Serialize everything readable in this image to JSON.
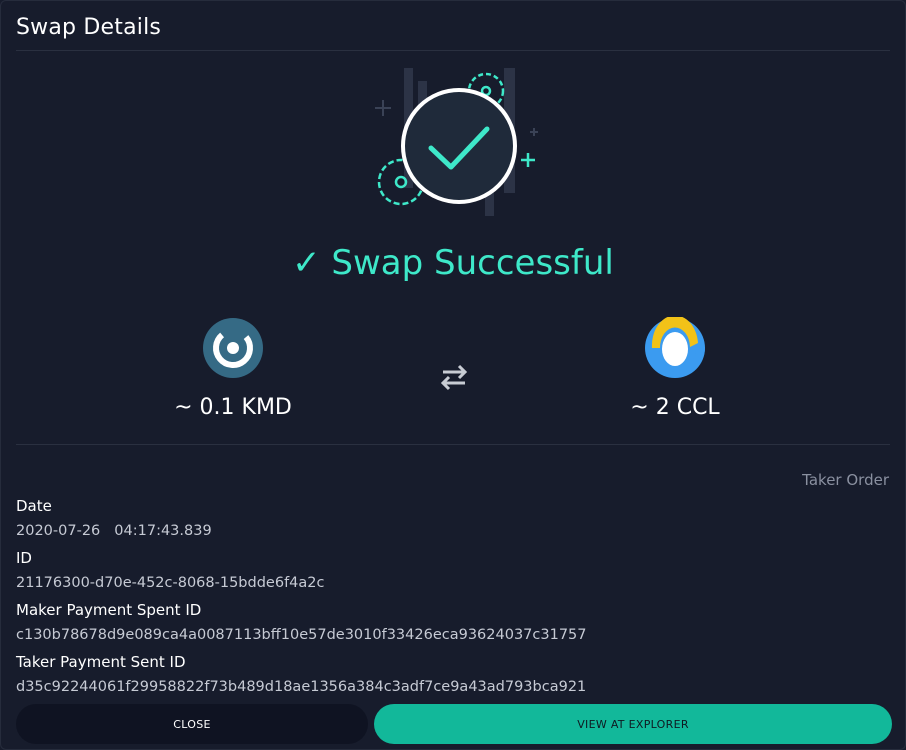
{
  "header": {
    "title": "Swap Details"
  },
  "status": {
    "text": "✓ Swap Successful",
    "color": "#3ee8c9"
  },
  "swap": {
    "from": {
      "amount": "~ 0.1 KMD",
      "icon": "kmd-coin-icon"
    },
    "to": {
      "amount": "~ 2 CCL",
      "icon": "ccl-coin-icon"
    },
    "direction_icon": "swap-arrows-icon"
  },
  "order_type": "Taker Order",
  "details": {
    "date_label": "Date",
    "date": "2020-07-26",
    "time": "04:17:43.839",
    "id_label": "ID",
    "id": "21176300-d70e-452c-8068-15bdde6f4a2c",
    "maker_label": "Maker Payment Spent ID",
    "maker_id": "c130b78678d9e089ca4a0087113bff10e57de3010f33426eca93624037c31757",
    "taker_label": "Taker Payment Sent ID",
    "taker_id": "d35c92244061f29958822f73b489d18ae1356a384c3adf7ce9a43ad793bca921"
  },
  "buttons": {
    "close": "CLOSE",
    "explorer": "VIEW AT EXPLORER"
  },
  "colors": {
    "background": "#171c2c",
    "accent": "#3ee8c9",
    "button_primary": "#12b89a"
  }
}
